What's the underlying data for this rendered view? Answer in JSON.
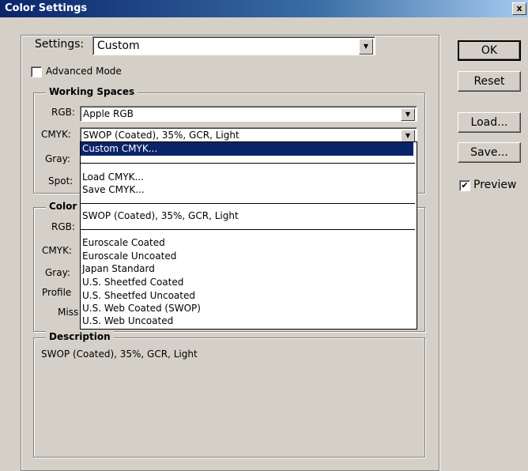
{
  "window": {
    "title": "Color Settings",
    "close_label": "x"
  },
  "settings": {
    "label": "Settings:",
    "value": "Custom"
  },
  "advanced_mode": {
    "label": "Advanced Mode",
    "checked": false
  },
  "working_spaces": {
    "legend": "Working Spaces",
    "rgb": {
      "label": "RGB:",
      "value": "Apple RGB"
    },
    "cmyk": {
      "label": "CMYK:",
      "value": "SWOP (Coated), 35%, GCR, Light"
    },
    "gray": {
      "label": "Gray:"
    },
    "spot": {
      "label": "Spot:"
    }
  },
  "color_policies": {
    "legend": "Color",
    "rgb": {
      "label": "RGB:"
    },
    "cmyk": {
      "label": "CMYK:"
    },
    "gray": {
      "label": "Gray:"
    },
    "profile": {
      "label": "Profile"
    },
    "miss": {
      "label": "Miss"
    }
  },
  "cmyk_dropdown": {
    "items": [
      "Custom CMYK...",
      "Load CMYK...",
      "Save CMYK...",
      "SWOP (Coated), 35%, GCR, Light",
      "Euroscale Coated",
      "Euroscale Uncoated",
      "Japan Standard",
      "U.S. Sheetfed Coated",
      "U.S. Sheetfed Uncoated",
      "U.S. Web Coated (SWOP)",
      "U.S. Web Uncoated"
    ]
  },
  "description": {
    "legend": "Description",
    "text": "SWOP (Coated), 35%, GCR, Light"
  },
  "buttons": {
    "ok": "OK",
    "reset": "Reset",
    "load": "Load...",
    "save": "Save..."
  },
  "preview": {
    "label": "Preview",
    "checked": true
  }
}
